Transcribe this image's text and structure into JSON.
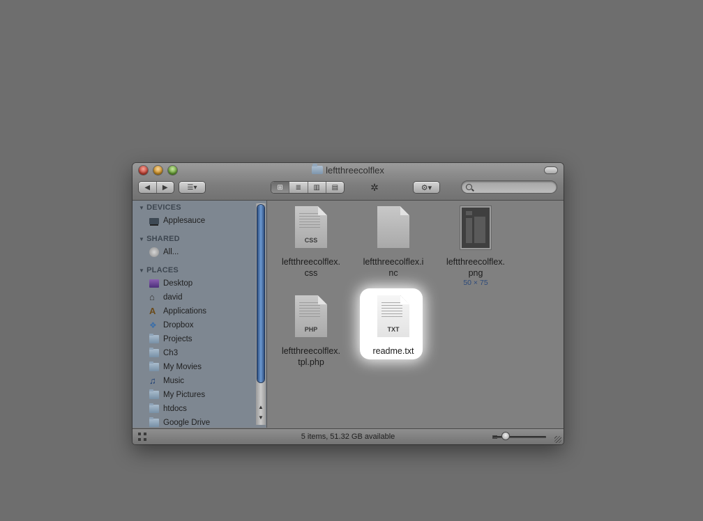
{
  "window": {
    "title": "leftthreecolflex"
  },
  "toolbar": {
    "back_icon": "back-arrow-icon",
    "forward_icon": "forward-arrow-icon",
    "arrange_icon": "arrange-menu-icon",
    "view_modes": [
      "icon-view",
      "list-view",
      "column-view",
      "coverflow-view"
    ],
    "active_view": "icon-view",
    "action_icon": "gear-icon",
    "search": {
      "value": "",
      "placeholder": ""
    }
  },
  "sidebar": {
    "sections": [
      {
        "title": "DEVICES",
        "items": [
          {
            "label": "Applesauce",
            "icon": "laptop-icon"
          }
        ]
      },
      {
        "title": "SHARED",
        "items": [
          {
            "label": "All...",
            "icon": "network-icon"
          }
        ]
      },
      {
        "title": "PLACES",
        "items": [
          {
            "label": "Desktop",
            "icon": "desktop-icon"
          },
          {
            "label": "david",
            "icon": "home-icon"
          },
          {
            "label": "Applications",
            "icon": "applications-icon"
          },
          {
            "label": "Dropbox",
            "icon": "dropbox-icon"
          },
          {
            "label": "Projects",
            "icon": "folder-icon"
          },
          {
            "label": "Ch3",
            "icon": "folder-icon"
          },
          {
            "label": "My Movies",
            "icon": "folder-icon"
          },
          {
            "label": "Music",
            "icon": "music-icon"
          },
          {
            "label": "My Pictures",
            "icon": "folder-icon"
          },
          {
            "label": "htdocs",
            "icon": "folder-icon"
          },
          {
            "label": "Google Drive",
            "icon": "folder-icon"
          }
        ]
      }
    ]
  },
  "files": [
    {
      "name": "leftthreecolflex.css",
      "line1": "leftthreecolflex.",
      "line2": "css",
      "badge": "CSS",
      "kind": "document",
      "selected": false
    },
    {
      "name": "leftthreecolflex.inc",
      "line1": "leftthreecolflex.i",
      "line2": "nc",
      "badge": "",
      "kind": "blank",
      "selected": false
    },
    {
      "name": "leftthreecolflex.png",
      "line1": "leftthreecolflex.",
      "line2": "png",
      "meta": "50 × 75",
      "kind": "image",
      "selected": false
    },
    {
      "name": "leftthreecolflex.tpl.php",
      "line1": "leftthreecolflex.",
      "line2": "tpl.php",
      "badge": "PHP",
      "kind": "document",
      "selected": false
    },
    {
      "name": "readme.txt",
      "line1": "readme.txt",
      "line2": "",
      "badge": "TXT",
      "kind": "document",
      "selected": true
    }
  ],
  "status": {
    "text": "5 items, 51.32 GB available"
  },
  "colors": {
    "desktop_bg": "#6e6e6e",
    "sidebar_bg": "#7e8791",
    "content_bg": "#808080",
    "scroll_thumb": "#4a74ad",
    "selection_glow": "#ffffff"
  }
}
